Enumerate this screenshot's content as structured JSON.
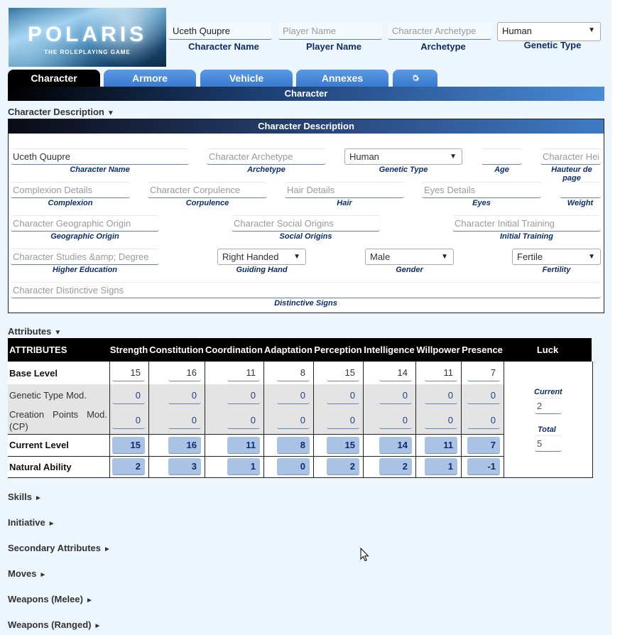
{
  "header": {
    "logo_title": "POLARIS",
    "logo_subtitle": "THE ROLEPLAYING GAME",
    "character_name": {
      "value": "Uceth Quupre",
      "label": "Character Name"
    },
    "player_name": {
      "value": "",
      "placeholder": "Player Name",
      "label": "Player Name"
    },
    "archetype": {
      "value": "",
      "placeholder": "Character Archetype",
      "label": "Archetype"
    },
    "genetic_type": {
      "value": "Human",
      "label": "Genetic Type"
    }
  },
  "tabs": [
    {
      "label": "Character",
      "active": true
    },
    {
      "label": "Armore",
      "active": false
    },
    {
      "label": "Vehicle",
      "active": false
    },
    {
      "label": "Annexes",
      "active": false
    },
    {
      "label": "",
      "icon": "gear-icon",
      "active": false
    }
  ],
  "tab_title": "Character",
  "description_section": {
    "heading": "Character Description",
    "box_title": "Character Description",
    "fields": {
      "name": {
        "value": "Uceth Quupre",
        "placeholder": "",
        "label": "Character Name"
      },
      "archetype": {
        "value": "",
        "placeholder": "Character Archetype",
        "label": "Archetype"
      },
      "genetic_type": {
        "value": "Human",
        "label": "Genetic Type"
      },
      "age": {
        "value": "",
        "placeholder": "",
        "label": "Age"
      },
      "height": {
        "value": "",
        "placeholder": "Character Hei",
        "label": "Hauteur de page"
      },
      "complexion": {
        "value": "",
        "placeholder": "Complexion Details",
        "label": "Complexion"
      },
      "corpulence": {
        "value": "",
        "placeholder": "Character Corpulence",
        "label": "Corpulence"
      },
      "hair": {
        "value": "",
        "placeholder": "Hair Details",
        "label": "Hair"
      },
      "eyes": {
        "value": "",
        "placeholder": "Eyes Details",
        "label": "Eyes"
      },
      "weight": {
        "value": "",
        "placeholder": "",
        "label": "Weight"
      },
      "geo_origin": {
        "value": "",
        "placeholder": "Character Geographic Origin",
        "label": "Geographic Origin"
      },
      "social_origin": {
        "value": "",
        "placeholder": "Character Social Origins",
        "label": "Social Origins"
      },
      "initial_training": {
        "value": "",
        "placeholder": "Character Initial Training",
        "label": "Initial Training"
      },
      "higher_education": {
        "value": "",
        "placeholder": "Character Studies &amp; Degree",
        "label": "Higher Education"
      },
      "guiding_hand": {
        "value": "Right Handed",
        "label": "Guiding Hand"
      },
      "gender": {
        "value": "Male",
        "label": "Gender"
      },
      "fertility": {
        "value": "Fertile",
        "label": "Fertility"
      },
      "distinctive_signs": {
        "value": "",
        "placeholder": "Character Distinctive Signs",
        "label": "Distinctive Signs"
      }
    }
  },
  "attributes_section": {
    "heading": "Attributes",
    "table_title": "ATTRIBUTES",
    "columns": [
      "Strength",
      "Constitution",
      "Coordination",
      "Adaptation",
      "Perception",
      "Intelligence",
      "Willpower",
      "Presence"
    ],
    "luck_header": "Luck",
    "rows": [
      {
        "label": "Base Level",
        "values": [
          "15",
          "16",
          "11",
          "8",
          "15",
          "14",
          "11",
          "7"
        ]
      },
      {
        "label": "Genetic Type Mod.",
        "values": [
          "0",
          "0",
          "0",
          "0",
          "0",
          "0",
          "0",
          "0"
        ]
      },
      {
        "label": "Creation Points Mod. (CP)",
        "values": [
          "0",
          "0",
          "0",
          "0",
          "0",
          "0",
          "0",
          "0"
        ]
      },
      {
        "label": "Current Level",
        "values": [
          "15",
          "16",
          "11",
          "8",
          "15",
          "14",
          "11",
          "7"
        ]
      },
      {
        "label": "Natural Ability",
        "values": [
          "2",
          "3",
          "1",
          "0",
          "2",
          "2",
          "1",
          "-1"
        ]
      }
    ],
    "luck": {
      "current_label": "Current",
      "current_value": "2",
      "total_label": "Total",
      "total_value": "5"
    }
  },
  "collapsed_sections": [
    "Skills",
    "Initiative",
    "Secondary Attributes",
    "Moves",
    "Weapons (Melee)",
    "Weapons (Ranged)"
  ],
  "arrows": {
    "expanded": "▼",
    "collapsed": "►"
  },
  "colors": {
    "navy_label": "#0d2c6e",
    "tab_blue": "#3a7ad0",
    "calc_cell": "#aac3e4",
    "page_bg": "#eef6fd"
  }
}
